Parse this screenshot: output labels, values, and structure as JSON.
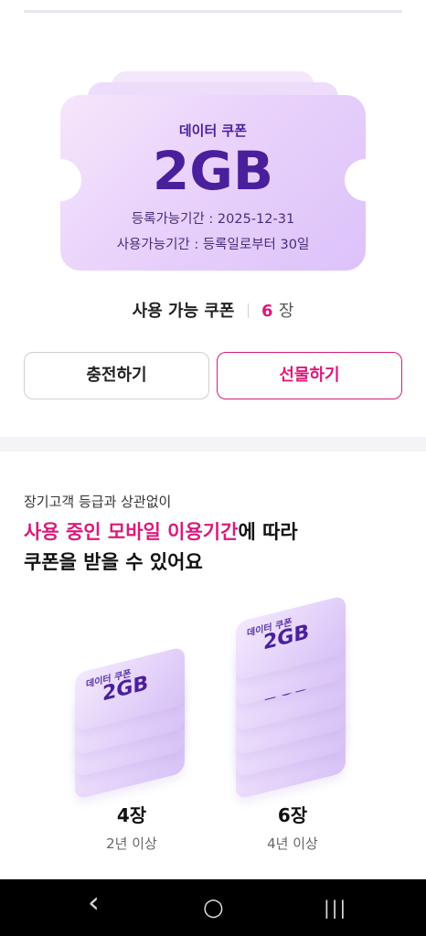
{
  "coupon": {
    "label": "데이터 쿠폰",
    "amount": "2GB",
    "register_period": "등록가능기간 : 2025-12-31",
    "use_period": "사용가능기간 : 등록일로부터 30일"
  },
  "available": {
    "label": "사용 가능 쿠폰",
    "count": "6",
    "unit": "장"
  },
  "buttons": {
    "charge": "충전하기",
    "gift": "선물하기"
  },
  "info": {
    "sub": "장기고객 등급과 상관없이",
    "title_highlight": "사용 중인 모바일 이용기간",
    "title_rest": "에 따라",
    "title_line2": "쿠폰을 받을 수 있어요"
  },
  "tiers": [
    {
      "count": "4장",
      "desc": "2년 이상",
      "tile_label": "데이터 쿠폰",
      "tile_amount": "2GB"
    },
    {
      "count": "6장",
      "desc": "4년 이상",
      "tile_label": "데이터 쿠폰",
      "tile_amount": "2GB"
    }
  ],
  "navbar": {
    "back_icon": "‹",
    "home_icon": "○",
    "recents_icon": "|||"
  },
  "colors": {
    "accent": "#d81b7a",
    "coupon_text": "#4a1f9c"
  }
}
